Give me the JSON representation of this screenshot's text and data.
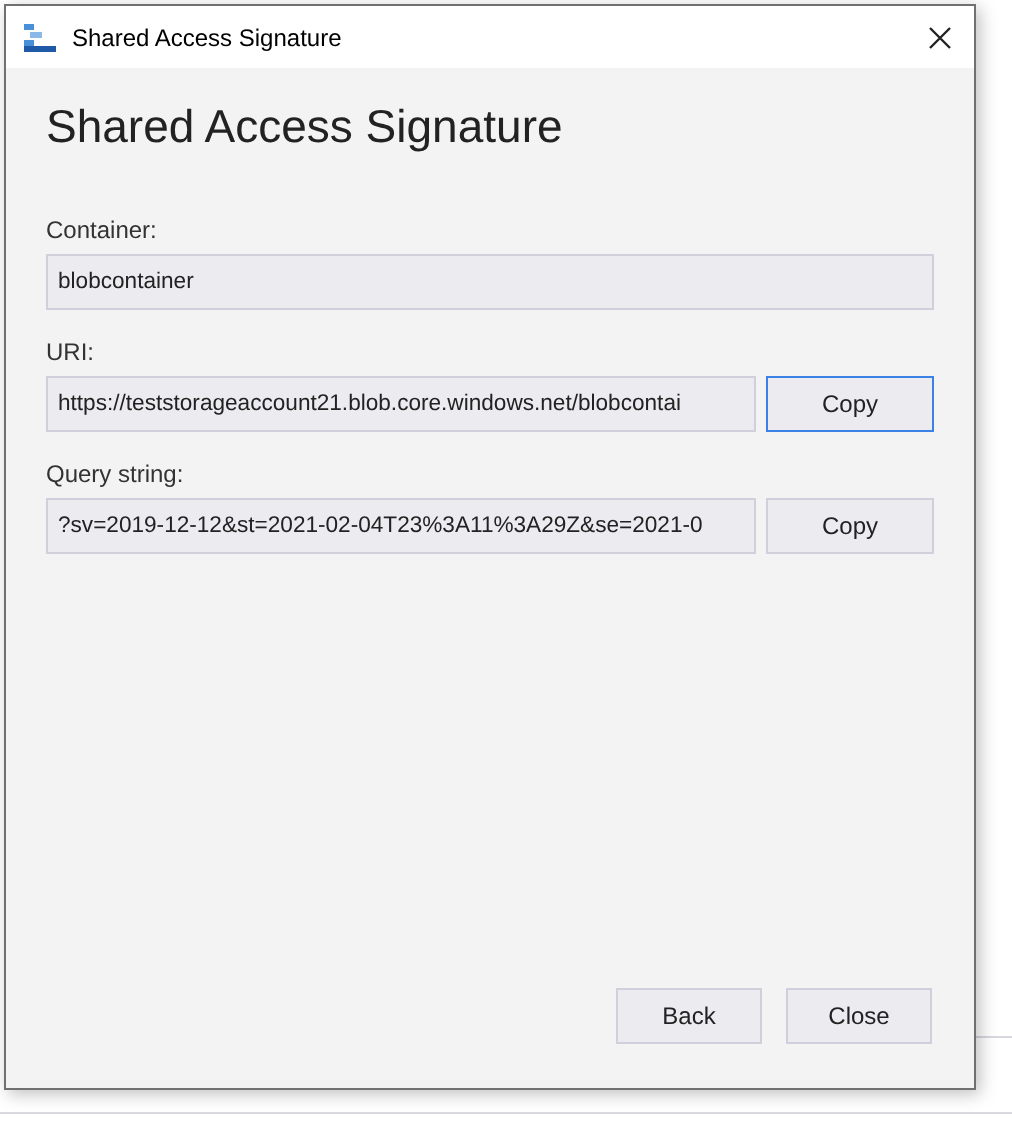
{
  "window": {
    "title": "Shared Access Signature"
  },
  "heading": "Shared Access Signature",
  "fields": [
    {
      "label": "Container:",
      "value": "blobcontainer"
    },
    {
      "label": "URI:",
      "value": "https://teststorageaccount21.blob.core.windows.net/blobcontai",
      "button": {
        "label": "Copy",
        "focused": true
      }
    },
    {
      "label": "Query string:",
      "value": "?sv=2019-12-12&st=2021-02-04T23%3A11%3A29Z&se=2021-0",
      "button": {
        "label": "Copy",
        "focused": false
      }
    }
  ],
  "buttons": [
    "Back",
    "Close"
  ]
}
